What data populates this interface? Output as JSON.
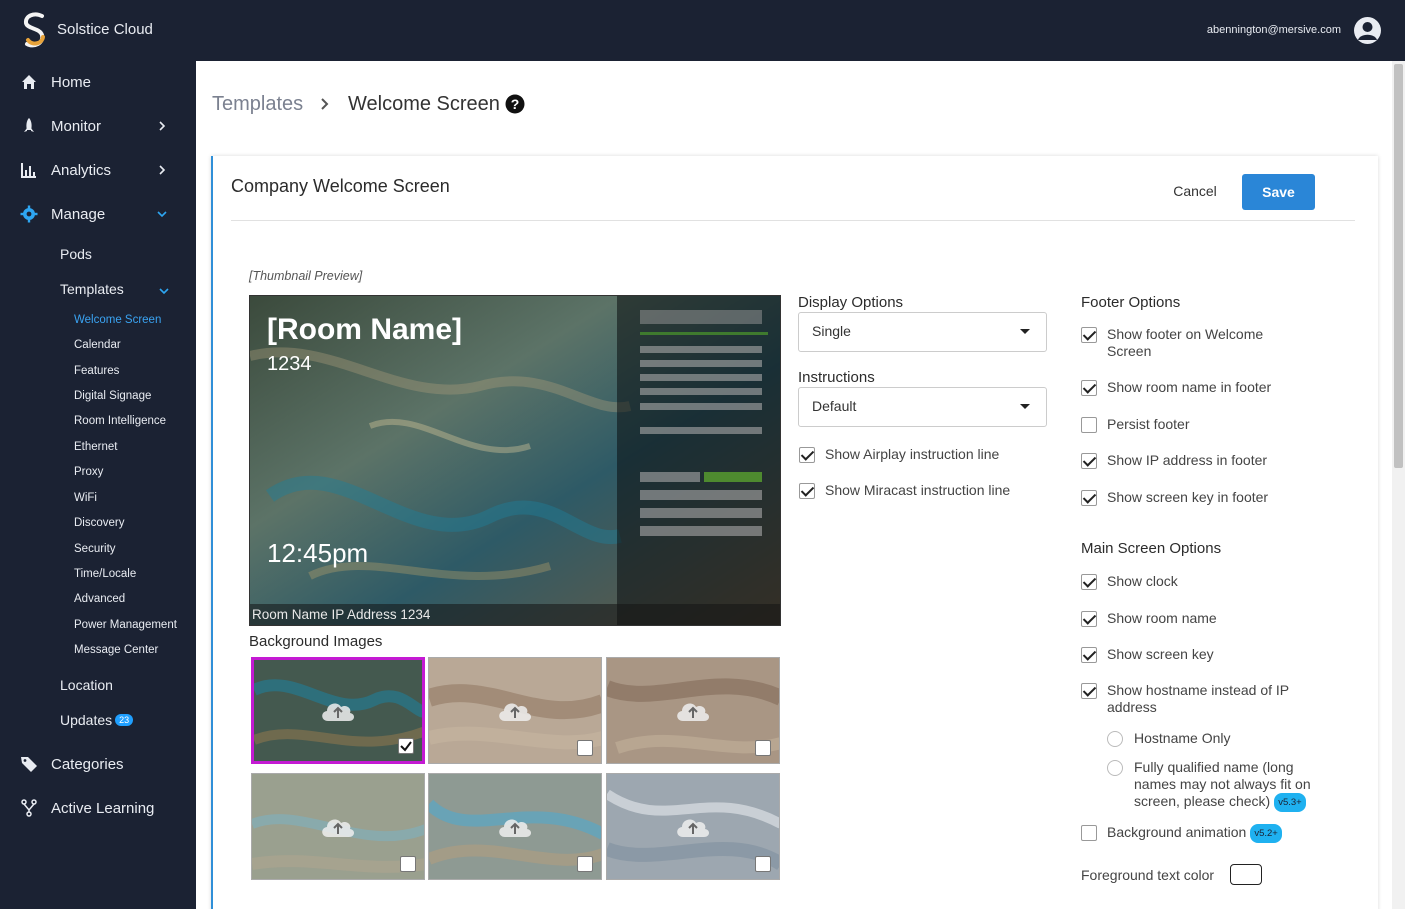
{
  "app": {
    "brand": "Solstice Cloud",
    "user_email": "abennington@mersive.com"
  },
  "sidebar": {
    "main": [
      {
        "label": "Home",
        "icon": "home-icon"
      },
      {
        "label": "Monitor",
        "icon": "rocket-icon"
      },
      {
        "label": "Analytics",
        "icon": "bar-chart-icon"
      },
      {
        "label": "Manage",
        "icon": "gear-icon"
      }
    ],
    "manage": {
      "pods": "Pods",
      "templates": "Templates",
      "location": "Location",
      "updates": "Updates",
      "updates_badge": "23"
    },
    "templates": [
      "Welcome Screen",
      "Calendar",
      "Features",
      "Digital Signage",
      "Room Intelligence",
      "Ethernet",
      "Proxy",
      "WiFi",
      "Discovery",
      "Security",
      "Time/Locale",
      "Advanced",
      "Power Management",
      "Message Center"
    ],
    "bottom": [
      {
        "label": "Categories",
        "icon": "tag-icon"
      },
      {
        "label": "Active Learning",
        "icon": "branch-icon"
      }
    ]
  },
  "breadcrumb": {
    "parent": "Templates",
    "current": "Welcome Screen"
  },
  "card": {
    "title": "Company Welcome Screen",
    "cancel": "Cancel",
    "save": "Save"
  },
  "preview": {
    "caption": "[Thumbnail Preview]",
    "room_name": "[Room Name]",
    "screen_key": "1234",
    "time": "12:45pm",
    "footer": "Room Name IP Address 1234"
  },
  "background_images": {
    "label": "Background Images",
    "selected_index": 0
  },
  "display_options": {
    "label": "Display Options",
    "value": "Single"
  },
  "instructions": {
    "label": "Instructions",
    "value": "Default"
  },
  "instruction_checks": [
    {
      "label": "Show Airplay instruction line",
      "checked": true
    },
    {
      "label": "Show Miracast instruction line",
      "checked": true
    }
  ],
  "footer_options": {
    "label": "Footer Options",
    "items": [
      {
        "label": "Show footer on Welcome Screen",
        "checked": true
      },
      {
        "label": "Show room name in footer",
        "checked": true
      },
      {
        "label": "Persist footer",
        "checked": false
      },
      {
        "label": "Show IP address in footer",
        "checked": true
      },
      {
        "label": "Show screen key in footer",
        "checked": true
      }
    ]
  },
  "main_screen_options": {
    "label": "Main Screen Options",
    "items": [
      {
        "label": "Show clock",
        "checked": true
      },
      {
        "label": "Show room name",
        "checked": true
      },
      {
        "label": "Show screen key",
        "checked": true
      },
      {
        "label": "Show hostname instead of IP address",
        "checked": true
      }
    ],
    "radios": [
      {
        "label": "Hostname Only"
      },
      {
        "label": "Fully qualified name (long names may not always fit on screen, please check)",
        "badge": "v5.3+"
      }
    ],
    "background_animation": {
      "label": "Background animation",
      "checked": false,
      "badge": "v5.2+"
    },
    "foreground_color_label": "Foreground text color"
  },
  "colors": {
    "sidebar": "#1b2233",
    "accent": "#2a86d7",
    "active_link": "#3aa3f2",
    "selected_tile": "#c41ad3"
  }
}
